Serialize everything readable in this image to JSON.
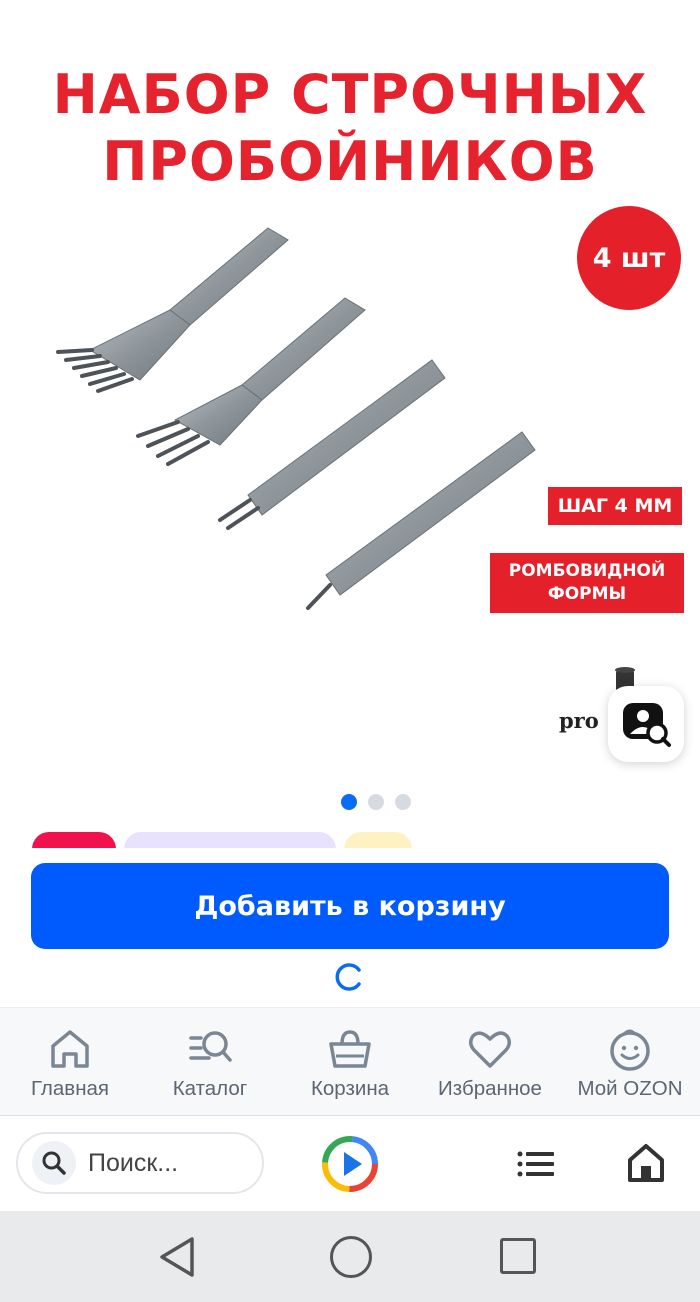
{
  "product": {
    "promo_title_line1": "НАБОР СТРОЧНЫХ",
    "promo_title_line2": "ПРОБОЙНИКОВ",
    "quantity_badge": "4 шт",
    "step_badge": "ШАГ 4 ММ",
    "shape_badge_line1": "РОМБОВИДНОЙ",
    "shape_badge_line2": "ФОРМЫ",
    "brand_logo_text": "pro",
    "image_count": 3,
    "active_image": 1
  },
  "action": {
    "add_to_cart_label": "Добавить в корзину"
  },
  "bottom_nav": {
    "items": [
      {
        "label": "Главная",
        "icon": "home-icon"
      },
      {
        "label": "Каталог",
        "icon": "catalog-search-icon"
      },
      {
        "label": "Корзина",
        "icon": "basket-icon"
      },
      {
        "label": "Избранное",
        "icon": "heart-icon"
      },
      {
        "label": "Мой OZON",
        "icon": "profile-smile-icon"
      }
    ]
  },
  "browser": {
    "search_placeholder": "Поиск..."
  },
  "colors": {
    "accent_blue": "#005bff",
    "promo_red": "#e4212b",
    "nav_gray": "#5b6675"
  }
}
